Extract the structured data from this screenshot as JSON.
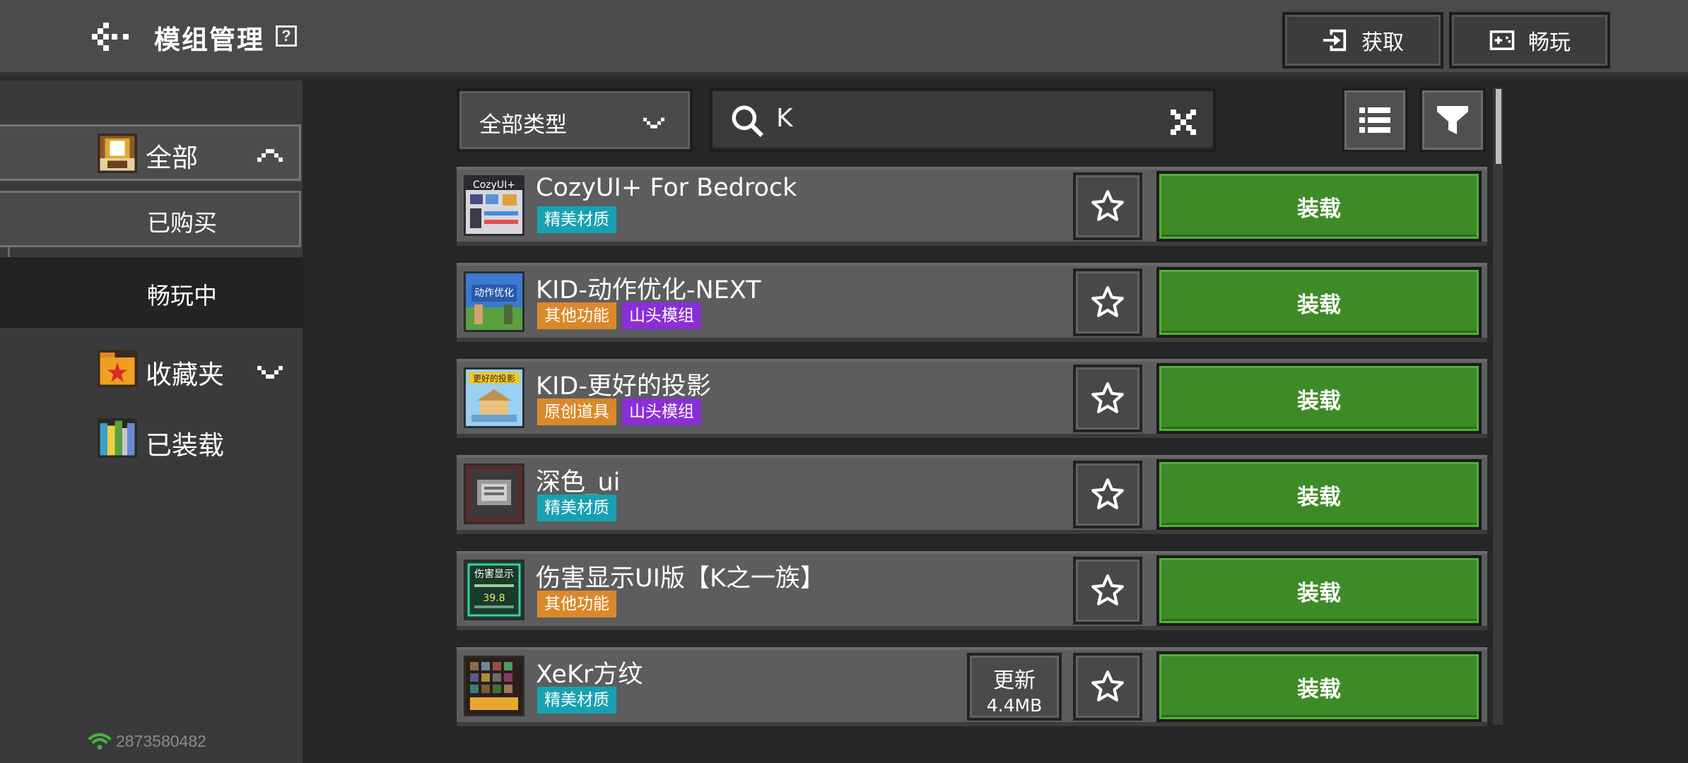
{
  "header": {
    "title": "模组管理",
    "help_icon": "help-icon",
    "get_label": "获取",
    "play_label": "畅玩"
  },
  "sidebar": {
    "all_label": "全部",
    "bought_label": "已购买",
    "playing_label": "畅玩中",
    "favorites_label": "收藏夹",
    "installed_label": "已装载",
    "account_id": "2873580482"
  },
  "toolbar": {
    "type_filter_value": "全部类型",
    "search_query": "K"
  },
  "mods": [
    {
      "title": "CozyUI+ For Bedrock",
      "tags": [
        {
          "label": "精美材质",
          "color": "cyan"
        }
      ],
      "install_label": "装载"
    },
    {
      "title": "KID-动作优化-NEXT",
      "tags": [
        {
          "label": "其他功能",
          "color": "orange"
        },
        {
          "label": "山头模组",
          "color": "purple"
        }
      ],
      "install_label": "装载"
    },
    {
      "title": "KID-更好的投影",
      "tags": [
        {
          "label": "原创道具",
          "color": "orange"
        },
        {
          "label": "山头模组",
          "color": "purple"
        }
      ],
      "install_label": "装载"
    },
    {
      "title": "深色_ui",
      "tags": [
        {
          "label": "精美材质",
          "color": "cyan"
        }
      ],
      "install_label": "装载"
    },
    {
      "title": "伤害显示UI版【K之一族】",
      "tags": [
        {
          "label": "其他功能",
          "color": "orange"
        }
      ],
      "install_label": "装载"
    },
    {
      "title": "XeKr方纹",
      "tags": [
        {
          "label": "精美材质",
          "color": "cyan"
        }
      ],
      "install_label": "装载",
      "update_label": "更新",
      "update_size": "4.4MB"
    }
  ],
  "colors": {
    "install_green": "#3c8b27",
    "tag_cyan": "#16a2b0",
    "tag_orange": "#d9892a",
    "tag_purple": "#8a2fd6"
  }
}
